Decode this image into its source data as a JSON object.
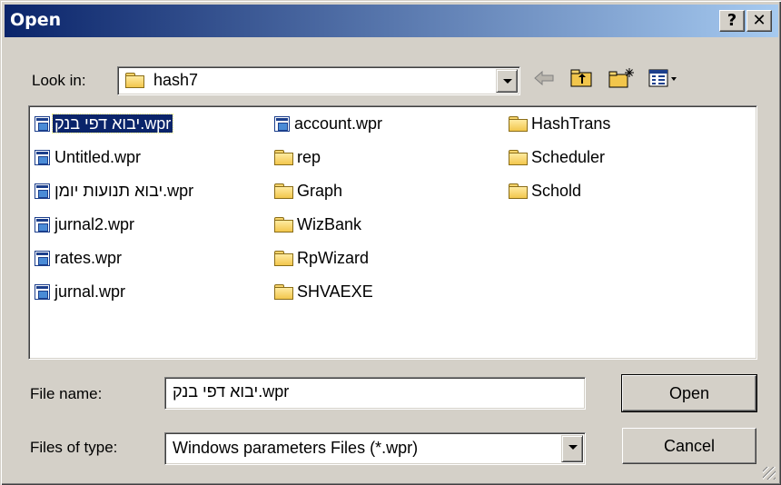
{
  "window": {
    "title": "Open",
    "help_label": "?",
    "close_label": "✕"
  },
  "lookin": {
    "label": "Look in:",
    "label_accel": "i",
    "value": "hash7"
  },
  "toolbar": {
    "back_icon": "back-arrow-icon",
    "up_icon": "up-folder-icon",
    "new_folder_icon": "new-folder-icon",
    "view_icon": "view-menu-icon"
  },
  "files": [
    {
      "name": "יבוא דפי בנק.wpr",
      "type": "file",
      "selected": true
    },
    {
      "name": "Untitled.wpr",
      "type": "file"
    },
    {
      "name": "יבוא תנועות יומן.wpr",
      "type": "file"
    },
    {
      "name": "jurnal2.wpr",
      "type": "file"
    },
    {
      "name": "rates.wpr",
      "type": "file"
    },
    {
      "name": "jurnal.wpr",
      "type": "file"
    },
    {
      "name": "account.wpr",
      "type": "file"
    },
    {
      "name": "rep",
      "type": "folder"
    },
    {
      "name": "Graph",
      "type": "folder"
    },
    {
      "name": "WizBank",
      "type": "folder"
    },
    {
      "name": "RpWizard",
      "type": "folder"
    },
    {
      "name": "SHVAEXE",
      "type": "folder"
    },
    {
      "name": "HashTrans",
      "type": "folder"
    },
    {
      "name": "Scheduler",
      "type": "folder"
    },
    {
      "name": "Schold",
      "type": "folder"
    }
  ],
  "filename": {
    "label": "File name:",
    "value": "יבוא דפי בנק.wpr"
  },
  "filetype": {
    "label": "Files of type:",
    "value": "Windows parameters Files (*.wpr)"
  },
  "buttons": {
    "open": "Open",
    "cancel": "Cancel"
  }
}
